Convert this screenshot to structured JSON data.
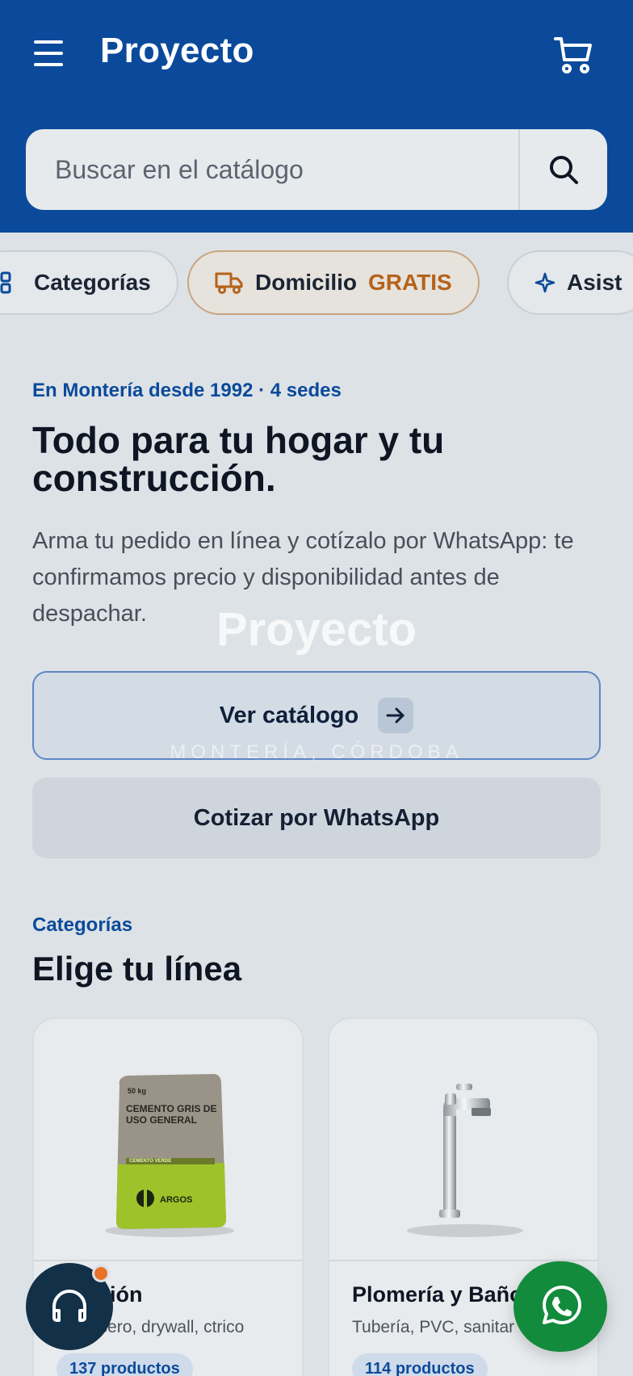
{
  "header": {
    "brand": "Proyecto",
    "menu_icon": "menu-icon",
    "cart_icon": "cart-icon",
    "background_color": "#0b4a9b"
  },
  "search": {
    "placeholder": "Buscar en el catálogo",
    "button_icon": "search-icon"
  },
  "chips": {
    "categories_label": "Categorías",
    "delivery_label": "Domicilio",
    "delivery_badge": "GRATIS",
    "assistant_label": "Asist",
    "accent_color": "#b4631a"
  },
  "hero": {
    "eyebrow": "En Montería desde 1992 · 4 sedes",
    "title": "Todo para tu hogar y tu construcción.",
    "text": "Arma tu pedido en línea y cotízalo por WhatsApp: te confirmamos precio y disponibilidad antes de despachar.",
    "watermark_brand": "Proyecto",
    "watermark_location": "MONTERÍA, CÓRDOBA",
    "catalog_button": "Ver catálogo",
    "whatsapp_button": "Cotizar por WhatsApp"
  },
  "categories": {
    "eyebrow": "Categorías",
    "title": "Elige tu línea",
    "items": [
      {
        "name": "trucción",
        "description": "nto, acero, drywall, ctrico",
        "count": "137 productos",
        "image_label_weight": "50 kg",
        "image_label_text": "CEMENTO GRIS DE USO GENERAL",
        "image_label_tag": "CEMENTO VERDE",
        "image_label_brand": "ARGOS"
      },
      {
        "name": "Plomería y Baño",
        "description": "Tubería, PVC, sanitar",
        "count": "114 productos"
      }
    ]
  },
  "floating": {
    "support_icon": "headset-icon",
    "whatsapp_icon": "whatsapp-icon",
    "notification_color": "#e8722a"
  }
}
